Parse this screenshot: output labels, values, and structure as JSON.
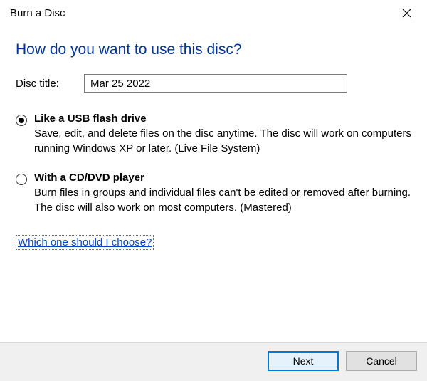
{
  "window": {
    "title": "Burn a Disc"
  },
  "main": {
    "heading": "How do you want to use this disc?",
    "discTitleLabel": "Disc title:",
    "discTitleValue": "Mar 25 2022",
    "options": [
      {
        "title": "Like a USB flash drive",
        "desc": "Save, edit, and delete files on the disc anytime. The disc will work on computers running Windows XP or later. (Live File System)",
        "selected": true
      },
      {
        "title": "With a CD/DVD player",
        "desc": "Burn files in groups and individual files can't be edited or removed after burning. The disc will also work on most computers. (Mastered)",
        "selected": false
      }
    ],
    "helpLink": "Which one should I choose?"
  },
  "footer": {
    "nextLabel": "Next",
    "cancelLabel": "Cancel"
  }
}
